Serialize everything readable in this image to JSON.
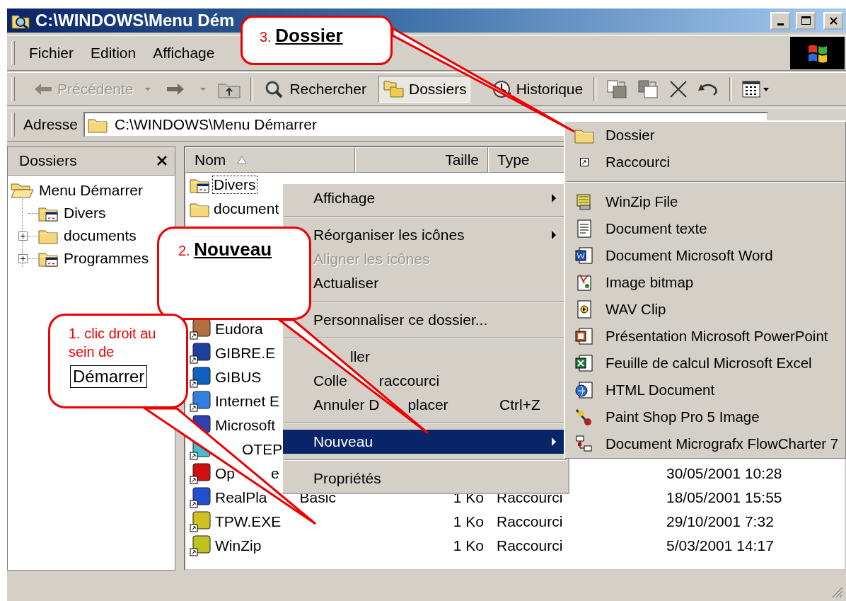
{
  "window": {
    "title": "C:\\WINDOWS\\Menu Dém"
  },
  "menu_bar": [
    {
      "label": "Fichier"
    },
    {
      "label": "Edition"
    },
    {
      "label": "Affichage"
    }
  ],
  "toolbar": {
    "back": {
      "label": "Précédente",
      "disabled": true
    },
    "buttons": [
      {
        "label": "Rechercher",
        "selected": false
      },
      {
        "label": "Dossiers",
        "selected": true
      },
      {
        "label": "Historique",
        "selected": false
      }
    ]
  },
  "address_bar": {
    "label": "Adresse",
    "value": "C:\\WINDOWS\\Menu Démarrer"
  },
  "folders_panel": {
    "title": "Dossiers",
    "tree": [
      {
        "label": "Menu Démarrer",
        "kind": "folder",
        "expanded": true,
        "children": [
          {
            "label": "Divers",
            "kind": "program-folder",
            "expandable": false
          },
          {
            "label": "documents",
            "kind": "folder",
            "expandable": true
          },
          {
            "label": "Programmes",
            "kind": "program-folder",
            "expandable": true
          }
        ]
      }
    ]
  },
  "file_list": {
    "columns": [
      {
        "label": "Nom",
        "sorted": true
      },
      {
        "label": "Taille",
        "sorted": false
      },
      {
        "label": "Type",
        "sorted": false
      }
    ],
    "rows_top": [
      {
        "name": "Divers",
        "kind": "program-folder",
        "focused": true
      },
      {
        "name": "document",
        "kind": "folder",
        "focused": false
      }
    ],
    "rows_bottom": [
      {
        "name": "Eudora",
        "kind": "shortcut",
        "focused": false
      },
      {
        "name": "GIBRE.E",
        "kind": "shortcut",
        "focused": false
      },
      {
        "name": "GIBUS",
        "kind": "shortcut",
        "focused": false
      },
      {
        "name": "Internet E",
        "kind": "shortcut",
        "focused": false
      },
      {
        "name": "Microsoft",
        "kind": "shortcut",
        "focused": false
      },
      {
        "name_after": "OTEP",
        "kind": "shortcut",
        "focused": false
      },
      {
        "name": "Op",
        "name_after": "e",
        "kind": "shortcut",
        "focused": false,
        "date": "30/05/2001 10:28"
      },
      {
        "name": "RealPla",
        "name_after": "Basic",
        "kind": "shortcut",
        "focused": false,
        "size": "1 Ko",
        "type": "Raccourci",
        "date": "18/05/2001 15:55"
      },
      {
        "name": "TPW.EXE",
        "kind": "shortcut",
        "focused": false,
        "size": "1 Ko",
        "type": "Raccourci",
        "date": "29/10/2001 7:32"
      },
      {
        "name": "WinZip",
        "kind": "shortcut",
        "focused": false,
        "size": "1 Ko",
        "type": "Raccourci",
        "date": "5/03/2001 14:17"
      }
    ]
  },
  "context_menu": {
    "items": [
      {
        "kind": "item",
        "label": "Affichage",
        "submenu": true,
        "disabled": false,
        "selected": false
      },
      {
        "kind": "separator"
      },
      {
        "kind": "item",
        "label": "Réorganiser les icônes",
        "submenu": true,
        "disabled": false,
        "selected": false
      },
      {
        "kind": "item",
        "label": "Aligner les icônes",
        "submenu": false,
        "disabled": true,
        "selected": false
      },
      {
        "kind": "item",
        "label": "Actualiser",
        "submenu": false,
        "disabled": false,
        "selected": false
      },
      {
        "kind": "separator"
      },
      {
        "kind": "item",
        "label": "Personnaliser ce dossier...",
        "submenu": false,
        "disabled": false,
        "selected": false
      },
      {
        "kind": "separator"
      },
      {
        "kind": "item",
        "label_after": "ller",
        "submenu": false,
        "disabled": false,
        "selected": false
      },
      {
        "kind": "item",
        "label": "Colle",
        "label_after": "raccourci",
        "submenu": false,
        "disabled": false,
        "selected": false
      },
      {
        "kind": "item",
        "label": "Annuler D",
        "label_after": "placer",
        "shortcut": "Ctrl+Z",
        "submenu": false,
        "disabled": false,
        "selected": false
      },
      {
        "kind": "separator"
      },
      {
        "kind": "item",
        "label": "Nouveau",
        "submenu": true,
        "disabled": false,
        "selected": true
      },
      {
        "kind": "separator"
      },
      {
        "kind": "item",
        "label": "Propriétés",
        "submenu": false,
        "disabled": false,
        "selected": false
      }
    ]
  },
  "new_submenu": {
    "items": [
      {
        "kind": "item",
        "label": "Dossier"
      },
      {
        "kind": "item",
        "label": "Raccourci"
      },
      {
        "kind": "separator"
      },
      {
        "kind": "item",
        "label": "WinZip File"
      },
      {
        "kind": "item",
        "label": "Document texte"
      },
      {
        "kind": "item",
        "label": "Document Microsoft Word"
      },
      {
        "kind": "item",
        "label": "Image bitmap"
      },
      {
        "kind": "item",
        "label": "WAV Clip"
      },
      {
        "kind": "item",
        "label": "Présentation Microsoft PowerPoint"
      },
      {
        "kind": "item",
        "label": "Feuille de calcul Microsoft Excel"
      },
      {
        "kind": "item",
        "label": "HTML Document"
      },
      {
        "kind": "item",
        "label": "Paint Shop Pro 5 Image"
      },
      {
        "kind": "item",
        "label": "Document Micrografx FlowCharter 7"
      }
    ]
  },
  "callouts": [
    {
      "text": "3. **Dossier**"
    },
    {
      "text": "2. **Nouveau**"
    },
    {
      "text": "1. clic droit au sein de",
      "boxed": "Démarrer"
    }
  ]
}
